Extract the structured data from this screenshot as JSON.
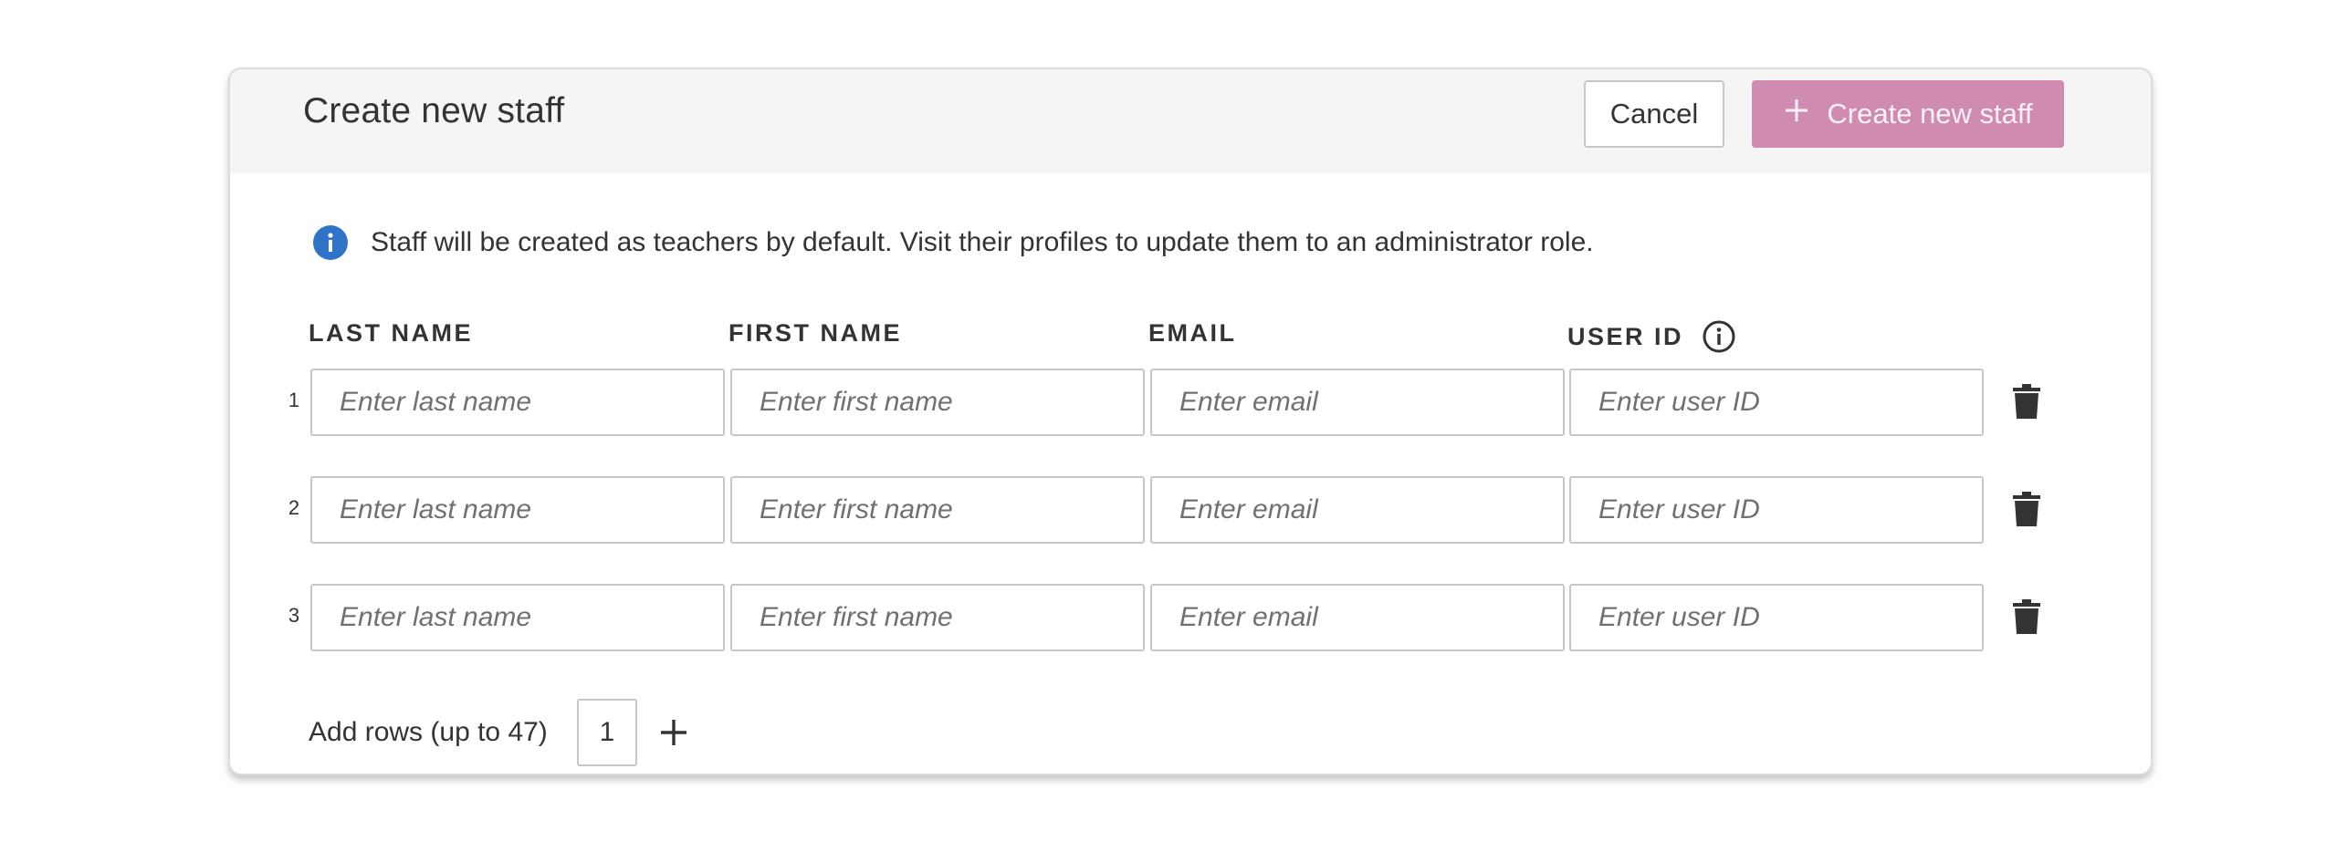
{
  "dialog": {
    "title": "Create new staff",
    "cancel_label": "Cancel",
    "create_label": "Create new staff",
    "create_button_color": "#cf8cb0"
  },
  "notice": {
    "icon": "info-icon",
    "text": "Staff will be created as teachers by default. Visit their profiles to update them to an administrator role."
  },
  "columns": {
    "last_name": "LAST NAME",
    "first_name": "FIRST NAME",
    "email": "EMAIL",
    "user_id": "USER ID"
  },
  "rows": [
    {
      "number": "1",
      "last_name_placeholder": "Enter last name",
      "first_name_placeholder": "Enter first name",
      "email_placeholder": "Enter email",
      "user_id_placeholder": "Enter user ID"
    },
    {
      "number": "2",
      "last_name_placeholder": "Enter last name",
      "first_name_placeholder": "Enter first name",
      "email_placeholder": "Enter email",
      "user_id_placeholder": "Enter user ID"
    },
    {
      "number": "3",
      "last_name_placeholder": "Enter last name",
      "first_name_placeholder": "Enter first name",
      "email_placeholder": "Enter email",
      "user_id_placeholder": "Enter user ID"
    }
  ],
  "add_rows": {
    "label": "Add rows (up to 47)",
    "value": "1"
  }
}
